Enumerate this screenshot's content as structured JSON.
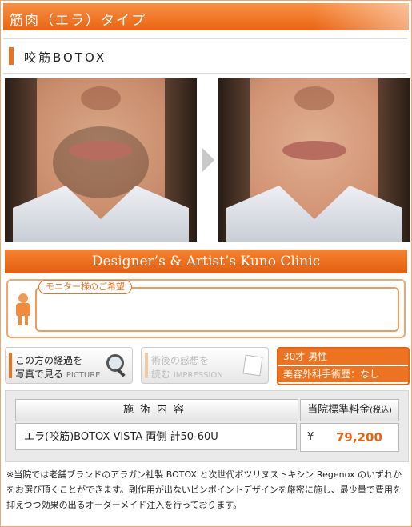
{
  "header": {
    "title": "筋肉（エラ）タイプ"
  },
  "subtitle": {
    "text": "咬筋BOTOX"
  },
  "photos": {
    "before_alt": "before",
    "after_alt": "after"
  },
  "banner": {
    "text": "Designer’s & Artist’s Kuno Clinic"
  },
  "request": {
    "tag": "モニター様のご希望",
    "text": ""
  },
  "buttons": {
    "progress": {
      "line1": "この方の経過を",
      "line2": "写真で見る",
      "en": "PICTURE"
    },
    "impression": {
      "line1": "術後の感想を",
      "line2": "読む",
      "en": "IMPRESSION"
    }
  },
  "profile": {
    "age_gender": "30才 男性",
    "history": "美容外科手術歴：なし"
  },
  "price_table": {
    "header_treatment": "施術内容",
    "header_price": "当院標準料金",
    "header_price_note": "(税込)",
    "treatment": "エラ(咬筋)BOTOX VISTA 両側 計50-60U",
    "currency": "¥",
    "amount": "79,200"
  },
  "footnote": "※当院では老舗ブランドのアラガン社製 BOTOX と次世代ボツリヌストキシン Regenox のいずれかをお選び頂くことができます。副作用が出ないピンポイントデザインを厳密に施し、最少量で費用を抑えつつ効果の出るオーダーメイド注入を行っております。",
  "colors": {
    "accent": "#ee7321",
    "accent_dark": "#e96412",
    "price": "#e96412"
  }
}
